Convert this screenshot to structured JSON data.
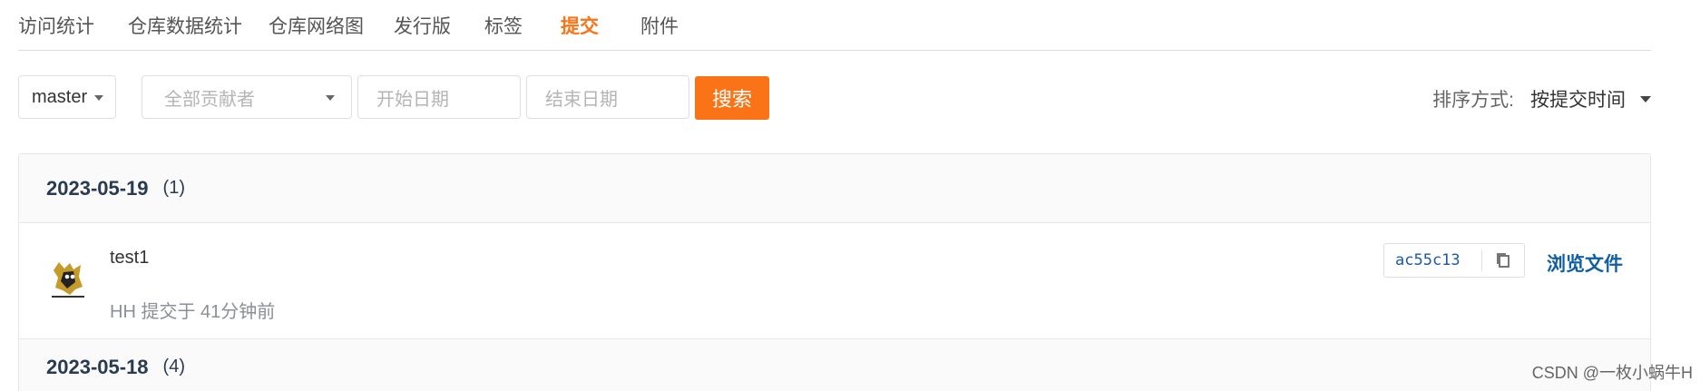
{
  "tabs": [
    {
      "label": "访问统计",
      "active": false
    },
    {
      "label": "仓库数据统计",
      "active": false
    },
    {
      "label": "仓库网络图",
      "active": false
    },
    {
      "label": "发行版",
      "active": false
    },
    {
      "label": "标签",
      "active": false
    },
    {
      "label": "提交",
      "active": true
    },
    {
      "label": "附件",
      "active": false
    }
  ],
  "filters": {
    "branch": "master",
    "contributor_placeholder": "全部贡献者",
    "start_placeholder": "开始日期",
    "end_placeholder": "结束日期",
    "search_label": "搜索",
    "sort_label": "排序方式:",
    "sort_value": "按提交时间"
  },
  "groups": [
    {
      "date": "2023-05-19",
      "count": "(1)",
      "commits": [
        {
          "title": "test1",
          "meta": "HH 提交于 41分钟前",
          "sha": "ac55c13",
          "browse_label": "浏览文件"
        }
      ]
    },
    {
      "date": "2023-05-18",
      "count": "(4)",
      "commits": []
    }
  ],
  "watermark": "CSDN @一枚小蜗牛H",
  "colors": {
    "accent": "#fa7316",
    "link": "#0f5fa6",
    "sha": "#1e5aa3"
  },
  "icons": {
    "copy": "copy-icon",
    "avatar": "avatar-image"
  }
}
